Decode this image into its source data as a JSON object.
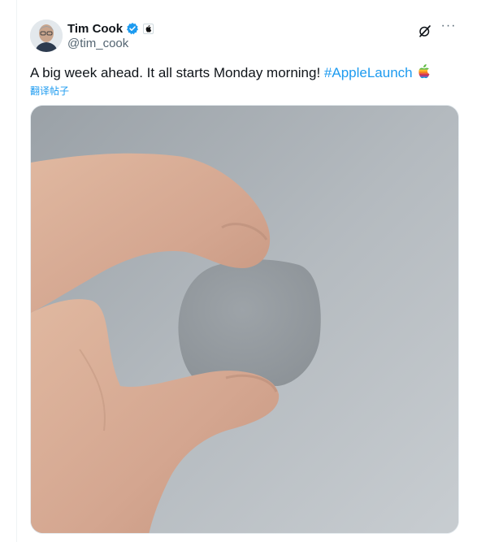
{
  "tweet": {
    "author": {
      "name": "Tim Cook",
      "handle": "@tim_cook"
    },
    "text": "A big week ahead. It all starts Monday morning! ",
    "hashtag": "#AppleLaunch",
    "translate_label": "翻译帖子",
    "more_label": "···",
    "media_icons": [
      "grok-icon",
      "more-icon",
      "verified-badge-icon",
      "apple-affiliate-icon",
      "rainbow-apple-emoji"
    ],
    "colors": {
      "link": "#1d9bf0",
      "verified": "#1d9bf0",
      "text": "#0f1419",
      "secondary": "#536471"
    }
  }
}
